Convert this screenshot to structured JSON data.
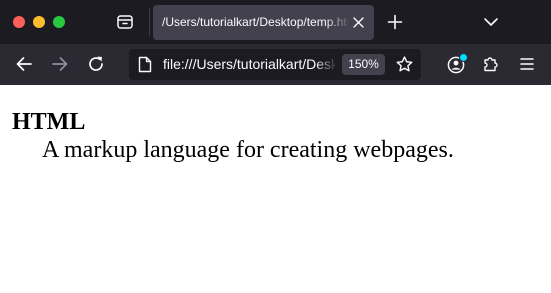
{
  "window": {
    "controls": [
      "close",
      "minimize",
      "zoom"
    ]
  },
  "tabs": [
    {
      "title": "/Users/tutorialkart/Desktop/temp.html",
      "active": true,
      "close_icon": "close-icon"
    }
  ],
  "tab_strip": {
    "overview_icon": "tab-overview-icon",
    "new_tab_icon": "plus-icon",
    "list_all_tabs_icon": "chevron-down-icon"
  },
  "toolbar": {
    "back_icon": "arrow-left-icon",
    "forward_icon": "arrow-right-icon",
    "reload_icon": "reload-icon",
    "account_icon": "account-icon",
    "extensions_icon": "puzzle-icon",
    "menu_icon": "hamburger-menu-icon"
  },
  "urlbar": {
    "url": "file:///Users/tutorialkart/Desktop/temp.html",
    "page_icon": "page-icon",
    "zoom": "150%",
    "bookmark_icon": "star-icon"
  },
  "page": {
    "term": "HTML",
    "definition": "A markup language for creating webpages."
  },
  "colors": {
    "tab_strip_bg": "#1c1b22",
    "toolbar_bg": "#2b2a33",
    "active_tab_bg": "#42414d",
    "urlbar_bg": "#1c1b22",
    "traffic_red": "#fe5f57",
    "traffic_yellow": "#febc2e",
    "traffic_green": "#28c840",
    "account_badge": "#00ddff"
  }
}
